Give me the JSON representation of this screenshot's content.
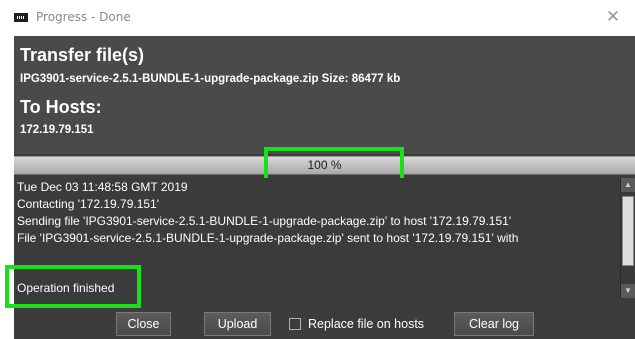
{
  "window": {
    "title": "Progress - Done",
    "icon": "app-window-icon",
    "close_glyph": "✕"
  },
  "header": {
    "title": "Transfer file(s)",
    "file_line": "IPG3901-service-2.5.1-BUNDLE-1-upgrade-package.zip Size: 86477 kb",
    "hosts_title": "To Hosts:",
    "host_ip": "172.19.79.151"
  },
  "progress": {
    "label": "100 %",
    "fraction": 1.0
  },
  "log": {
    "lines": [
      "Tue Dec 03 11:48:58 GMT 2019",
      "Contacting '172.19.79.151'",
      "Sending file  'IPG3901-service-2.5.1-BUNDLE-1-upgrade-package.zip' to host '172.19.79.151'",
      "File  'IPG3901-service-2.5.1-BUNDLE-1-upgrade-package.zip' sent to host '172.19.79.151' with",
      "",
      "Operation finished"
    ]
  },
  "buttons": {
    "close": "Close",
    "upload": "Upload",
    "replace_label": "Replace file on hosts",
    "replace_checked": false,
    "clear_log": "Clear log"
  },
  "colors": {
    "highlight": "#19e019",
    "panel": "#3c3c3c",
    "header": "#4a4a4a"
  }
}
